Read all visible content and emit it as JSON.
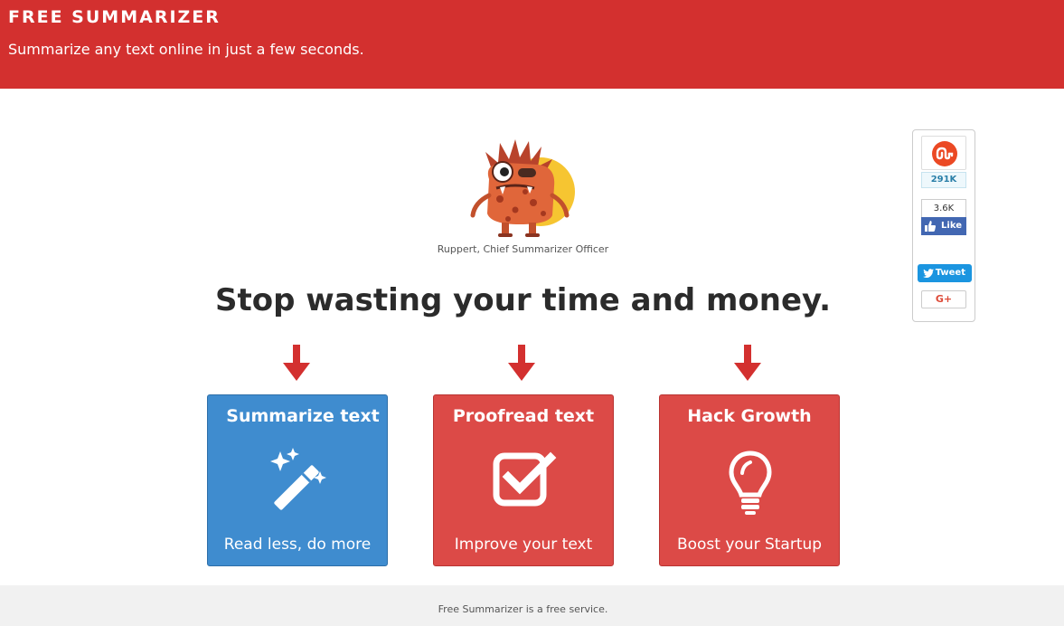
{
  "header": {
    "title": "FREE SUMMARIZER",
    "subtitle": "Summarize any text online in just a few seconds."
  },
  "mascot": {
    "caption": "Ruppert, Chief Summarizer Officer",
    "icon": "monster-mascot"
  },
  "headline": "Stop wasting your time and money.",
  "cards": [
    {
      "title": "Summarize text",
      "subtitle": "Read less, do more",
      "icon": "magic-wand-icon",
      "color": "#3f8ccf"
    },
    {
      "title": "Proofread text",
      "subtitle": "Improve your text",
      "icon": "checkbox-icon",
      "color": "#dc4a47"
    },
    {
      "title": "Hack Growth",
      "subtitle": "Boost your Startup",
      "icon": "lightbulb-icon",
      "color": "#dc4a47"
    }
  ],
  "share": {
    "stumbleupon_count": "291K",
    "facebook_count": "3.6K",
    "facebook_label": "Like",
    "tweet_label": "Tweet",
    "gplus_label": "G+"
  },
  "footer": {
    "text": "Free Summarizer is a free service."
  },
  "colors": {
    "brand_red": "#d3302f",
    "card_blue": "#3f8ccf",
    "card_red": "#dc4a47",
    "arrow_red": "#d3302f"
  }
}
